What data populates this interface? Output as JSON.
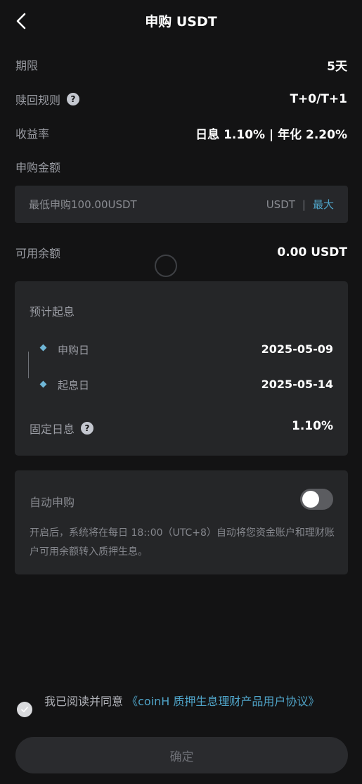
{
  "header": {
    "title": "申购 USDT"
  },
  "info": {
    "term_label": "期限",
    "term_value": "5天",
    "redeem_label": "赎回规则",
    "redeem_value": "T+0/T+1",
    "yield_label": "收益率",
    "yield_value": "日息 1.10% | 年化 2.20%"
  },
  "amount": {
    "label": "申购金额",
    "value": "",
    "placeholder": "最低申购100.00USDT",
    "unit": "USDT",
    "separator": "|",
    "max_label": "最大"
  },
  "balance": {
    "label": "可用余额",
    "value": "0.00 USDT"
  },
  "estimate": {
    "title": "预计起息",
    "subscribe_label": "申购日",
    "subscribe_date": "2025-05-09",
    "start_label": "起息日",
    "start_date": "2025-05-14",
    "fixed_label": "固定日息",
    "fixed_value": "1.10%"
  },
  "auto": {
    "label": "自动申购",
    "enabled": false,
    "description": "开启后，系统将在每日 18::00（UTC+8）自动将您资金账户和理财账户可用余额转入质押生息。"
  },
  "agreement": {
    "prefix": "我已阅读并同意",
    "link": "《coinH 质押生息理财产品用户协议》"
  },
  "confirm_label": "确定",
  "colors": {
    "accent": "#4fa3c7",
    "background": "#131314",
    "card": "#252628"
  },
  "icons": {
    "back": "chevron-left-icon",
    "help": "question-circle-icon",
    "check": "check-icon"
  }
}
